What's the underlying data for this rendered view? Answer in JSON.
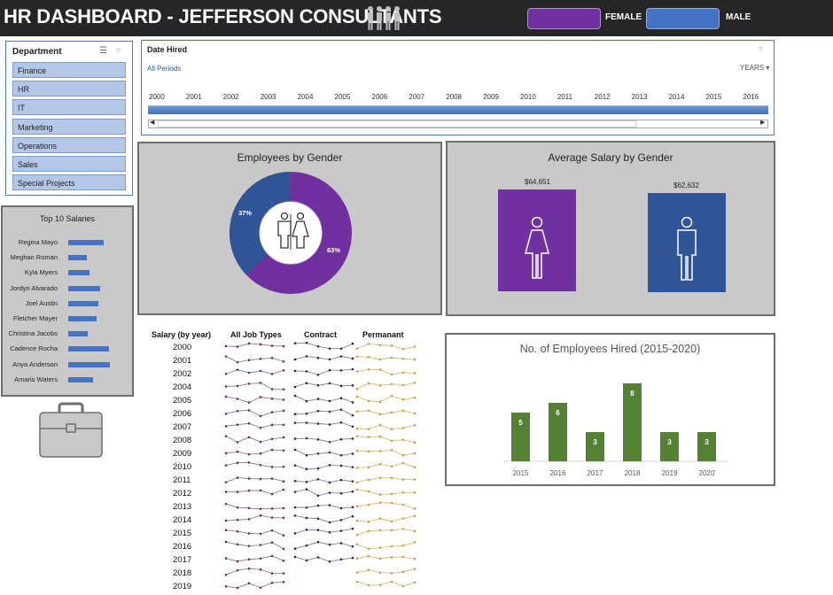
{
  "header": {
    "title": "HR DASHBOARD - JEFFERSON CONSULTANTS",
    "legend": [
      {
        "label": "FEMALE",
        "color": "#7030a0"
      },
      {
        "label": "MALE",
        "color": "#4472c4"
      }
    ]
  },
  "department_slicer": {
    "title": "Department",
    "items": [
      "Finance",
      "HR",
      "IT",
      "Marketing",
      "Operations",
      "Sales",
      "Special Projects"
    ]
  },
  "timeline": {
    "title": "Date Hired",
    "period_label": "All Periods",
    "level_label": "YEARS",
    "years": [
      "2000",
      "2001",
      "2002",
      "2003",
      "2004",
      "2005",
      "2006",
      "2007",
      "2008",
      "2009",
      "2010",
      "2011",
      "2012",
      "2013",
      "2014",
      "2015",
      "2016"
    ]
  },
  "top10": {
    "title": "Top 10 Salaries",
    "names": [
      "Regina Mayo",
      "Meghan Roman",
      "Kyla Myers",
      "Jordyn Alvarado",
      "Joel Austin",
      "Fletcher Mayer",
      "Christina Jacobs",
      "Cadence Rocha",
      "Anya Anderson",
      "Amaris Waters"
    ],
    "relative_values": [
      0.84,
      0.43,
      0.49,
      0.76,
      0.7,
      0.67,
      0.45,
      0.96,
      0.98,
      0.59
    ],
    "color": "#4472c4"
  },
  "gender_chart": {
    "title": "Employees by Gender",
    "male_label": "37%",
    "female_label": "63%"
  },
  "salary_chart": {
    "title": "Average Salary by Gender",
    "female_label": "$64,651",
    "male_label": "$62,632"
  },
  "sparklines": {
    "headers": [
      "Salary (by year)",
      "All Job Types",
      "Contract",
      "Permanant"
    ],
    "years": [
      "2000",
      "2001",
      "2002",
      "2004",
      "2005",
      "2006",
      "2007",
      "2008",
      "2009",
      "2010",
      "2011",
      "2012",
      "2013",
      "2014",
      "2015",
      "2016",
      "2017",
      "2018",
      "2019"
    ],
    "colors": {
      "all": "#8e1f3f",
      "contract": "#1f2a5a",
      "permanent": "#c8a040"
    }
  },
  "chart_data": {
    "type": "bar",
    "title": "No. of Employees Hired (2015-2020)",
    "categories": [
      "2015",
      "2016",
      "2017",
      "2018",
      "2019",
      "2020"
    ],
    "values": [
      5,
      6,
      3,
      8,
      3,
      3
    ],
    "ylim": [
      0,
      9
    ],
    "color": "#548235",
    "grid": false
  }
}
